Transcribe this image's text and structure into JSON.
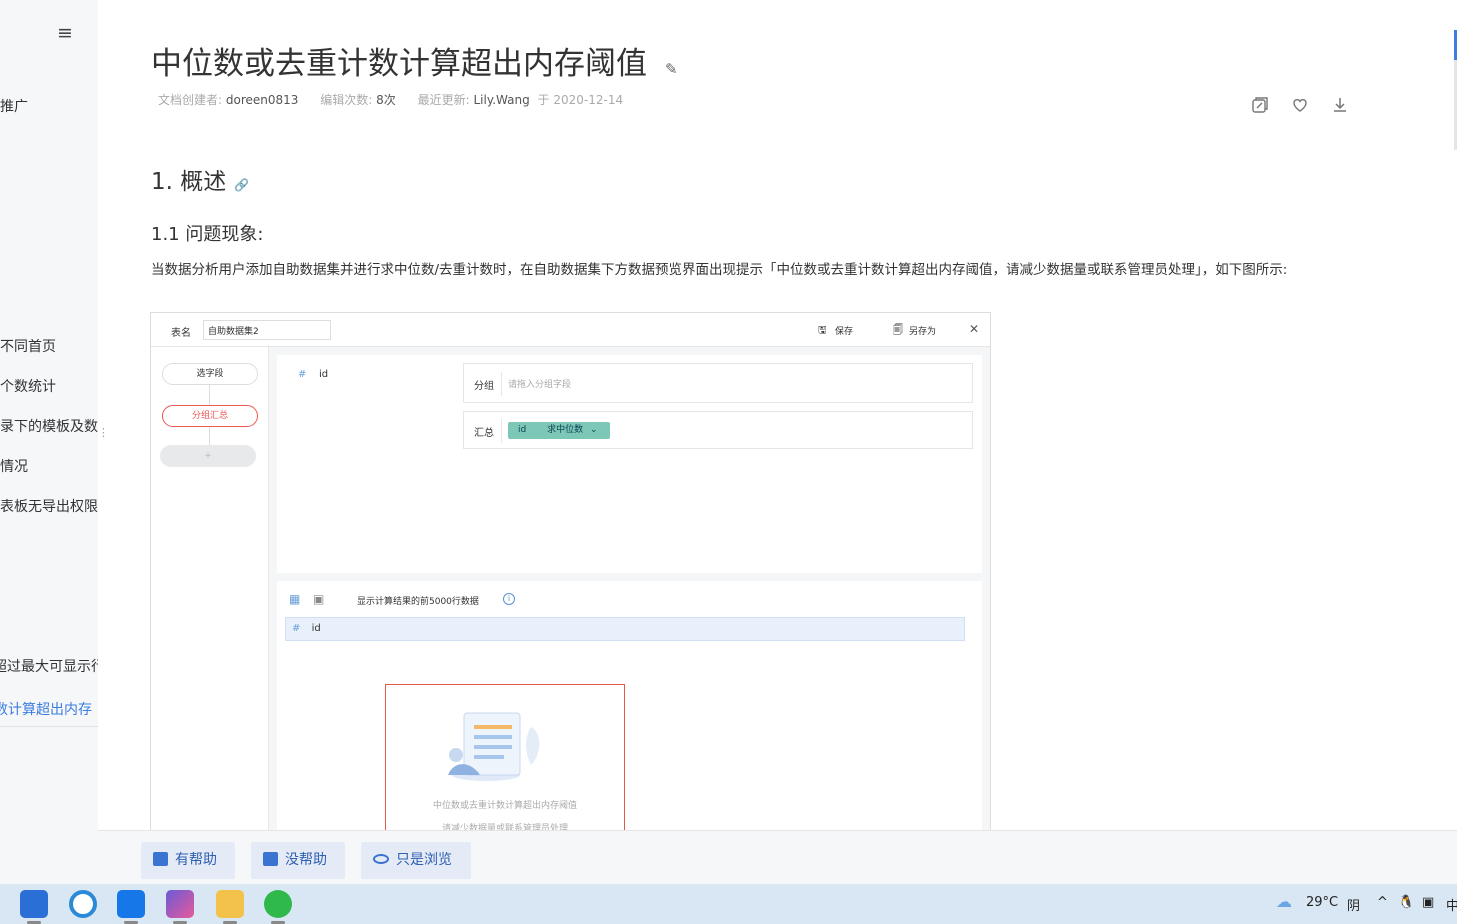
{
  "sidebar": {
    "menu_icon": "≡",
    "items": [
      "推广",
      "不同首页",
      "个数统计",
      "录下的模板及数",
      "情况",
      "表板无导出权限",
      "超过最大可显示行",
      "数计算超出内存"
    ]
  },
  "article": {
    "title": "中位数或去重计数计算超出内存阈值",
    "meta": {
      "creator_label": "文档创建者:",
      "creator": "doreen0813",
      "edits_label": "编辑次数:",
      "edits": "8次",
      "updated_label": "最近更新:",
      "updated_by": "Lily.Wang",
      "updated_on": "于 2020-12-14"
    },
    "h1": "1. 概述",
    "h2": "1.1 问题现象:",
    "paragraph": "当数据分析用户添加自助数据集并进行求中位数/去重计数时，在自助数据集下方数据预览界面出现提示「中位数或去重计数计算超出内存阈值，请减少数据量或联系管理员处理」，如下图所示:"
  },
  "figure": {
    "table_label": "表名",
    "table_name": "自助数据集2",
    "save": "保存",
    "save_as": "另存为",
    "close": "✕",
    "steps": [
      "选字段",
      "分组汇总",
      "+"
    ],
    "field_hash": "#",
    "field_name": "id",
    "group_label": "分组",
    "group_placeholder": "请拖入分组字段",
    "summary_label": "汇总",
    "chip_field": "id",
    "chip_agg": "求中位数",
    "preview_note": "显示计算结果的前5000行数据",
    "info": "i",
    "column": "id",
    "warn_line1": "中位数或去重计数计算超出内存阈值",
    "warn_line2": "请减少数据量或联系管理员处理"
  },
  "feedback": {
    "helpful": "有帮助",
    "not_helpful": "没帮助",
    "just_browse": "只是浏览"
  },
  "tray": {
    "temperature": "29°C",
    "weather": "阴",
    "chevron": "^",
    "speaker": "中"
  },
  "colors": {
    "accent": "#3b7de0",
    "warn": "#e05b4b",
    "chip": "#7cc7b6"
  }
}
